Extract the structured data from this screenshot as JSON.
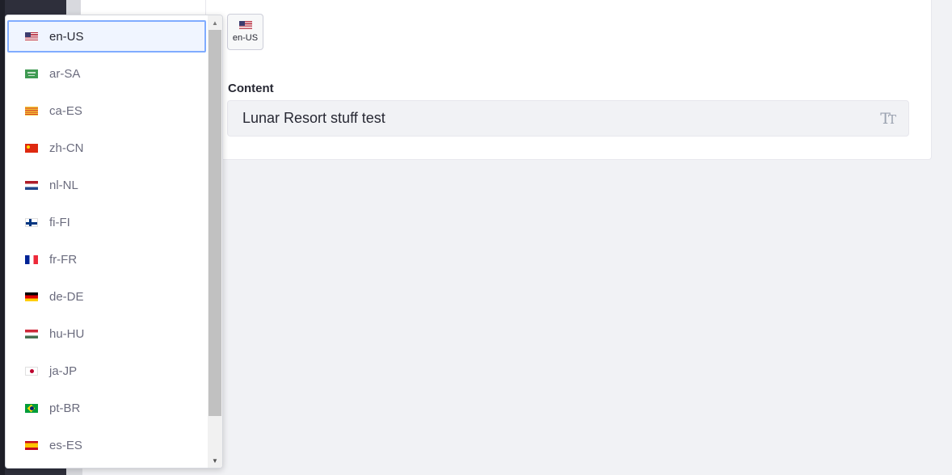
{
  "locale_selector": {
    "current_locale": "en-US",
    "current_flag": "flag-us"
  },
  "content_field": {
    "label": "Content",
    "value": "Lunar Resort stuff test",
    "icon": "text-format-icon"
  },
  "dropdown": {
    "selected_index": 0,
    "items": [
      {
        "label": "en-US",
        "flag": "flag-us"
      },
      {
        "label": "ar-SA",
        "flag": "flag-sa"
      },
      {
        "label": "ca-ES",
        "flag": "flag-ca"
      },
      {
        "label": "zh-CN",
        "flag": "flag-cn"
      },
      {
        "label": "nl-NL",
        "flag": "flag-nl"
      },
      {
        "label": "fi-FI",
        "flag": "flag-fi"
      },
      {
        "label": "fr-FR",
        "flag": "flag-fr"
      },
      {
        "label": "de-DE",
        "flag": "flag-de"
      },
      {
        "label": "hu-HU",
        "flag": "flag-hu"
      },
      {
        "label": "ja-JP",
        "flag": "flag-jp"
      },
      {
        "label": "pt-BR",
        "flag": "flag-br"
      },
      {
        "label": "es-ES",
        "flag": "flag-es"
      }
    ]
  },
  "colors": {
    "accent": "#80acff",
    "selected_bg": "#f0f5ff",
    "sidebar": "#2e2f3b"
  }
}
